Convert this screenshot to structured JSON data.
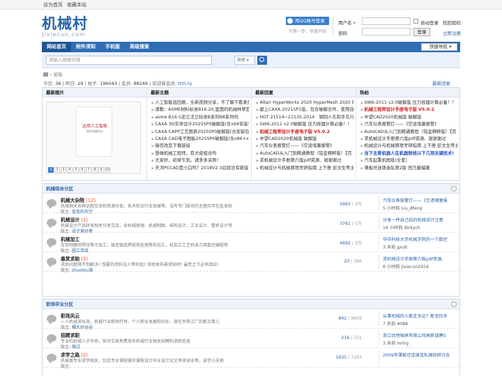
{
  "topbar": {
    "links": [
      "设为首页",
      "收藏本站"
    ]
  },
  "logo": {
    "main": "机械村",
    "sub": "Jixiecun.com"
  },
  "qq": {
    "label": "用QQ帐号登录",
    "note": "只需一步，快速开始"
  },
  "login": {
    "username_label": "用户名",
    "username_arrow": "▾",
    "password_label": "密码",
    "auto_login": "自动登录",
    "find_password": "找回密码",
    "login_button": "登录",
    "register": "立即注册"
  },
  "nav": {
    "items": [
      "网站首页",
      "附件须知",
      "手机版",
      "高级搜索"
    ],
    "quick": "快捷导航 ▾"
  },
  "search": {
    "placeholder": "请输入搜索内容",
    "select": "搜索 ▾"
  },
  "breadcrumb": {
    "current": "论坛"
  },
  "stats": {
    "today_label": "今日:",
    "today": "36",
    "yesterday_label": "昨日:",
    "yesterday": "29",
    "posts_label": "帖子:",
    "posts": "196043",
    "members_label": "会员:",
    "members": "88246",
    "welcome_label": "欢迎新会员:",
    "welcome": "ttth.ty",
    "latest": "最新回复"
  },
  "columns": {
    "images": {
      "title": "最新图片",
      "cover_title": "运用人工智能",
      "cover_sub": "提升机械设计",
      "pages": [
        "1",
        "2",
        "3",
        "4",
        "5",
        "6",
        "7",
        "8",
        "9",
        "10"
      ]
    },
    "topics": {
      "title": "最新主题",
      "items": [
        {
          "t": "人工智能巡回展，全新视频分享，不了解下看来是",
          "c": ""
        },
        {
          "t": "请教：ASME材料标准B16.20,里面的机械林翠是什",
          "c": ""
        },
        {
          "t": "asme B16.5还兰法兰标准B系列B8系列吗",
          "c": ""
        },
        {
          "t": "CAXA 3D实体设计2025SP0破解版(含x64安装包和",
          "c": ""
        },
        {
          "t": "CAXA CAPP工艺图表2025SP0破解版(含安装包和",
          "c": ""
        },
        {
          "t": "CAXA CAD电子图板2025SP0破解版(含x86+x64安",
          "c": ""
        },
        {
          "t": "输否改变下载链接",
          "c": ""
        },
        {
          "t": "想做机械工程师，有大佬组合吗",
          "c": ""
        },
        {
          "t": "大家好，初来乍到，请多多关照！",
          "c": ""
        },
        {
          "t": "天河PCCAD是小白吗？2018V2.3后就没有新版",
          "c": ""
        }
      ]
    },
    "replies": {
      "title": "最新回复",
      "items": [
        {
          "t": "Altair HyperWorks 2020 HyperMesh 2020 破解",
          "c": ""
        },
        {
          "t": "献上CAXA 2021SP1版，包含破解文件，使用自",
          "c": ""
        },
        {
          "t": "HGT 21514~21535-2014　钢制人孔和手孔行标",
          "c": ""
        },
        {
          "t": "SW6-2011 v2.0破解版 压力容器计算必备！！",
          "c": ""
        },
        {
          "t": "机械工程师设计手册电子版 V5.0.2",
          "c": "red"
        },
        {
          "t": "中望CAD2020机械版 破解版",
          "c": ""
        },
        {
          "t": "汽车仪表报警灯——《空滤堵塞报警》",
          "c": ""
        },
        {
          "t": "AutoCAD从入门到精通教程（铂金精粹版）【百",
          "c": ""
        },
        {
          "t": "求机械设计手册第六版pdf资源、谢谢谢过",
          "c": ""
        },
        {
          "t": "机械设计与机械原理考研指南 上下册 彭文生等主",
          "c": ""
        }
      ]
    },
    "hot": {
      "title": "热帖",
      "items": [
        {
          "t": "SW6-2011 v2.0破解版 压力容器计算必备！！",
          "c": ""
        },
        {
          "t": "机械工程师设计手册电子版 V5.0.2",
          "c": "red"
        },
        {
          "t": "中望CAD2020机械版 破解版",
          "c": ""
        },
        {
          "t": "汽车仪表报警灯——《空滤堵塞报警》",
          "c": ""
        },
        {
          "t": "AutoCAD从入门到精通教程（铂金精粹版）【百",
          "c": ""
        },
        {
          "t": "求机械设计手册第六版pdf资源、谢谢谢过",
          "c": ""
        },
        {
          "t": "机械设计与机械原理考研指南 上下册 彭文生等主",
          "c": ""
        },
        {
          "t": "当下主要机器人在机器射线以下几项关键技术!",
          "c": "blue"
        },
        {
          "t": "汽车起重机图纸(全套)",
          "c": ""
        },
        {
          "t": "薄板坯连铸连轧第2版 田乃媛编著",
          "c": ""
        }
      ]
    }
  },
  "sections": [
    {
      "title": "机械综合分区",
      "forums": [
        {
          "name": "机械大杂院",
          "today": " (12)",
          "desc": "机械相关各种话题交流和资源分享。技术前沿行业发展等。没有专门版块的主题均可在此发帖",
          "mod_label": "版主:",
          "mod": "蓝色的天空",
          "count_a": "5963",
          "count_b": "2万",
          "last_title": "汽车仪表报警灯——《空滤堵塞报",
          "last_meta": "5 小时前 Liu_dfeng"
        },
        {
          "name": "机械设计",
          "today": " (1)",
          "desc": "机械设计产品研发相关分享交流，含机械原理、机械制图、结构设计、工业设计、整机设计等",
          "mod_label": "版主:",
          "mod": "设计爱好者",
          "count_a": "3761",
          "count_b": "1万",
          "last_title": "分享一件自己绘的机械设计注意",
          "last_meta": "14 小时前 dickych"
        },
        {
          "name": "机械加工",
          "today": "",
          "desc": "车铣刨磨钳焊压等冷加工，铸造锻造焊接热处理等热加工，机加工工艺机床刀具数控编程等",
          "mod_label": "版主:",
          "mod": "圈工百段",
          "count_a": "4892",
          "count_b": "2万",
          "last_title": "华中科技大学机械学院的一个数控",
          "last_meta": "3 天前 jpcdi"
        },
        {
          "name": "悬赏求助",
          "today": " (2)",
          "desc": "求助问题得不到解决? 想要的资料没人帮你找? 求助发布悬赏贴吧! 最荒之下必有回应!",
          "mod_label": "版主:",
          "mod": "zhuotou谁",
          "count_a": "20",
          "count_b": "366",
          "last_title": "求机械设计手册第六版pdf资源、",
          "last_meta": "6 小时前 jixiecun2016"
        }
      ]
    },
    {
      "title": "职场学业分区",
      "forums": [
        {
          "name": "职场风云",
          "today": "",
          "desc": "一人机械深似海，机械行业职场打拼、个人职业发展和创业、身在世界工厂的那点事儿",
          "mod_label": "版主:",
          "mod": "橘大好谷谷",
          "count_a": "842",
          "count_b": "9659",
          "last_title": "从事机械的人能走多远？能坚持多",
          "last_meta": "7 天前 4088"
        },
        {
          "name": "招聘求职",
          "today": "",
          "desc": "专业的机械人才市场，供对交易免费发布机械行业相关招聘和求职信息",
          "mod_label": "版主:",
          "mod": "微过",
          "count_a": "216",
          "count_b": "721",
          "last_title": "浙江优特轴承有限公司高薪诚聘S",
          "last_meta": "3 天前 mrlrg"
        },
        {
          "name": "求学之路",
          "today": " (2)",
          "desc": "机械类专业求学相关，包括专业课程操作课程设计毕业设计论文考研读业等，自学小天地",
          "mod_label": "版主:",
          "mod": "",
          "count_a": "1635",
          "count_b": "7283",
          "last_title": "2009年薄板坯连铸连轧国际研讨会",
          "last_meta": ""
        }
      ]
    }
  ]
}
